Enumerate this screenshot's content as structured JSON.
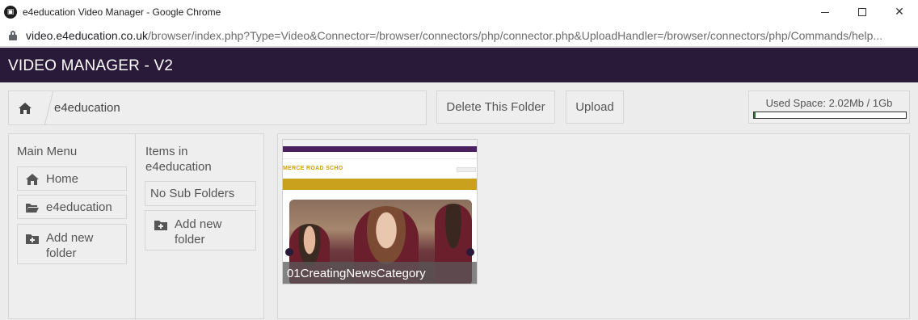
{
  "browser": {
    "window_title": "e4education Video Manager - Google Chrome",
    "url_host": "video.e4education.co.uk",
    "url_path": "/browser/index.php?Type=Video&Connector=/browser/connectors/php/connector.php&UploadHandler=/browser/connectors/php/Commands/help..."
  },
  "app": {
    "title": "VIDEO MANAGER - V2",
    "header_color": "#2a1a3a"
  },
  "toolbar": {
    "breadcrumb_folder": "e4education",
    "delete_label": "Delete This Folder",
    "upload_label": "Upload",
    "used_space_label": "Used Space: 2.02Mb / 1Gb",
    "used_space_fraction": 0.002,
    "used_space_color": "#2b7a2b"
  },
  "main_menu": {
    "title": "Main Menu",
    "items": [
      {
        "label": "Home",
        "icon": "home-icon"
      },
      {
        "label": "e4education",
        "icon": "folder-open-icon"
      },
      {
        "label": "Add new folder",
        "icon": "folder-plus-icon"
      }
    ]
  },
  "items_panel": {
    "title": "Items in e4education",
    "no_sub_label": "No Sub Folders",
    "add_new_label": "Add new folder"
  },
  "videos": [
    {
      "caption": "01CreatingNewsCategory",
      "school_banner": "MERCE ROAD SCHO"
    }
  ]
}
